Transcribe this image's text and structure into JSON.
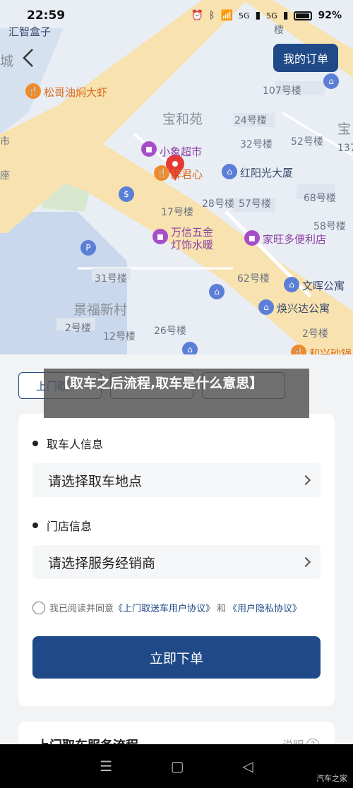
{
  "status_bar": {
    "time": "22:59",
    "battery": "92%",
    "net_label_1": "5G",
    "net_label_2": "5G"
  },
  "header": {
    "back_icon": "chevron-left-icon",
    "my_order_label": "我的订单"
  },
  "map": {
    "labels": [
      "汇智盒子",
      "城",
      "松哥油焖大虾",
      "宝和苑",
      "24号楼",
      "107号楼",
      "52号楼",
      "32号楼",
      "小象超市",
      "醉君心",
      "红阳光大厦",
      "68号楼",
      "17号楼",
      "28号楼",
      "57号楼",
      "58号楼",
      "万信五金",
      "灯饰水暖",
      "家旺多便利店",
      "31号楼",
      "62号楼",
      "文晖公寓",
      "景福新村",
      "焕兴达公寓",
      "2号楼",
      "12号楼",
      "26号楼",
      "2号楼",
      "和兴砂锅",
      "市",
      "座",
      "宝",
      "137",
      "楼"
    ],
    "colors": {
      "road": "#f7e2b0",
      "water": "#c9d8ec",
      "green": "#d7e8cf",
      "ground": "#e9eef5"
    }
  },
  "tabs": [
    "上门取",
    "",
    ""
  ],
  "form": {
    "section_pickup_title": "取车人信息",
    "pickup_placeholder": "请选择取车地点",
    "section_store_title": "门店信息",
    "store_placeholder": "请选择服务经销商",
    "agreement_prefix": "我已阅读并同意",
    "agreement_link1": "《上门取送车用户协议》",
    "agreement_and": "和",
    "agreement_link2": "《用户隐私协议》",
    "submit_label": "立即下单"
  },
  "process": {
    "title": "上门取车服务流程",
    "help_label": "说明"
  },
  "caption": "【取车之后流程,取车是什么意思】",
  "watermark": "汽车之家",
  "nav": {
    "menu_icon": "menu-icon",
    "home_icon": "home-icon",
    "back_icon": "back-icon"
  }
}
